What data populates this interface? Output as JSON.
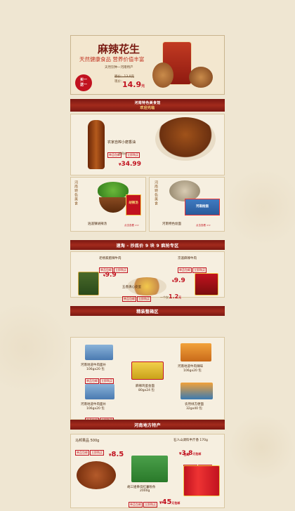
{
  "hero": {
    "title": "麻辣花生",
    "subtitle": "天然健康食品 营养价值丰富",
    "note": "天然饮种一河南特产",
    "orig_label": "原价：13.0元",
    "sale_label": "现价：",
    "sale_price": "14.9",
    "unit": "元",
    "badge_line1": "买一",
    "badge_line2": "送一"
  },
  "welcome": {
    "title": "河南特色美食馆",
    "sub": "欢迎光临"
  },
  "featured": {
    "name": "农家自榨小磨香油",
    "tags": [
      "单品包邮",
      "立即购买"
    ],
    "price_label": "抢购价",
    "currency": "¥",
    "price": "34.99"
  },
  "pair": [
    {
      "vlabel": "河南特色美食",
      "name": "逍遥镇胡辣汤",
      "tag": "点击查看 >>",
      "pack_text": "胡辣汤"
    },
    {
      "vlabel": "河南特色美食",
      "name": "河南特色烩面",
      "tag": "点击查看 >>",
      "pack_text": "河南烩面"
    }
  ],
  "band1": {
    "label": "速淘 - 抄底价 9 块 9 疯抢专区"
  },
  "deals": {
    "left": {
      "name": "老杨家腊辣牛肉",
      "tags": [
        "单品包邮",
        "立即购买"
      ],
      "currency": "¥",
      "price": "9.9"
    },
    "right": {
      "name": "京遥麻辣牛肉",
      "tags": [
        "单品包邮",
        "立即购买"
      ],
      "currency": "¥",
      "price": "9.9"
    },
    "center": {
      "name": "五香清心皮蛋",
      "tags": [
        "单品包邮",
        "立即购买"
      ],
      "unit_label": "一个仅",
      "price": "1.2",
      "unit": "元"
    }
  },
  "band2": {
    "label": "精装整箱区"
  },
  "boxes": [
    {
      "name": "河南地道牛肉面补",
      "spec": "106gx20 包"
    },
    {
      "name": "河南地道牛肉辣味",
      "spec": "106gx20 包"
    },
    {
      "name": "麻辣鸡蛋会面",
      "spec": "80gx24 包"
    },
    {
      "name": "河南地道牛肉面补",
      "spec": "106gx20 包"
    },
    {
      "name": "农然绿方便面",
      "spec": "32gx40 包"
    }
  ],
  "boxes_tags": [
    "单品包邮",
    "立即购买"
  ],
  "band3": {
    "label": "河南地方特产"
  },
  "specialty": {
    "jujube": {
      "name": "马邦果品 500g",
      "currency": "¥",
      "price": "8.5",
      "tags": [
        "单品包邮",
        "立即购买"
      ]
    },
    "peanut": {
      "name": "石人山调料半斤香 170g",
      "currency": "¥",
      "price": "3.8",
      "suffix": "元包邮",
      "shipping": "包邮",
      "tags": [
        "单品包邮",
        "立即购买"
      ]
    },
    "gift": {
      "name": "胡三姐拳母红薯粉条",
      "spec": "2000g",
      "currency": "¥",
      "price": "45",
      "suffix": "元包邮",
      "tags": [
        "单品包邮",
        "立即购买"
      ]
    }
  },
  "colors": {
    "accent": "#a22a1c",
    "price": "#c1121f",
    "bg": "#efe6d2"
  }
}
